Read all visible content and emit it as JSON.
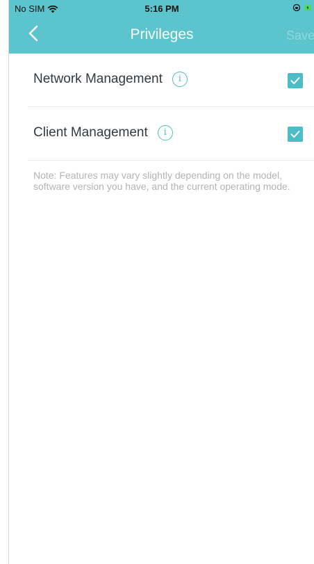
{
  "status_bar": {
    "carrier": "No SIM",
    "time": "5:16 PM"
  },
  "header": {
    "title": "Privileges",
    "save_label": "Save",
    "background_color": "#5bc4cc",
    "back_icon": "chevron-left-icon"
  },
  "privileges": [
    {
      "label": "Network Management",
      "checked": true,
      "info_glyph": "i"
    },
    {
      "label": "Client Management",
      "checked": true,
      "info_glyph": "i"
    }
  ],
  "note": "Note: Features may vary slightly depending on the model, software version you have, and the current operating mode.",
  "colors": {
    "accent": "#4dbcc6",
    "note_text": "#b3b3b3",
    "save_disabled": "#8fd8de"
  }
}
